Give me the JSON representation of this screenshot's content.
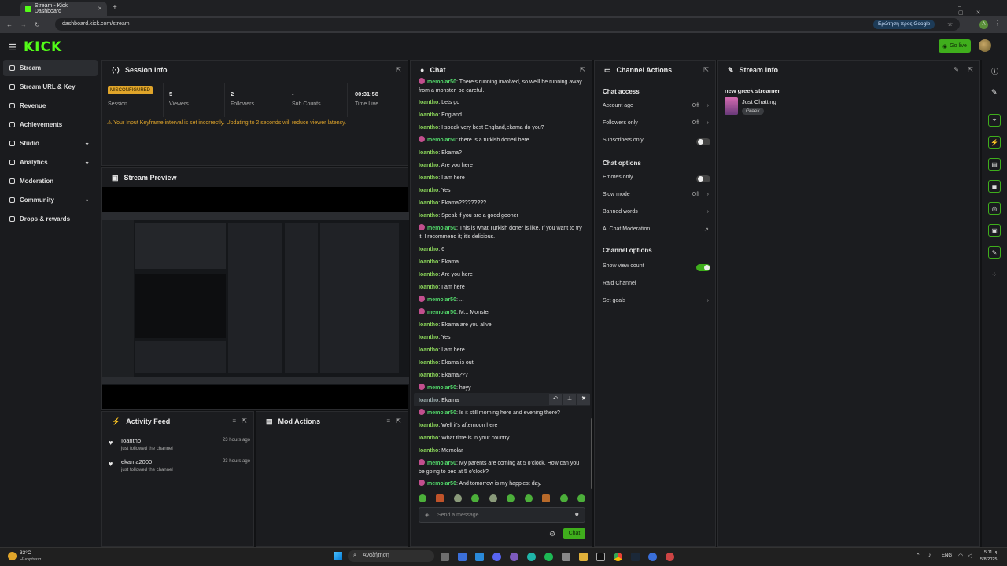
{
  "browser": {
    "tab_title": "Stream - Kick Dashboard",
    "url": "dashboard.kick.com/stream",
    "google_pill": "Ερώτηση προς Google",
    "profile_initial": "A"
  },
  "header": {
    "logo": "KICK",
    "go_live": "Go live"
  },
  "sidebar": {
    "items": [
      {
        "label": "Stream",
        "icon": "broadcast-icon",
        "active": true
      },
      {
        "label": "Stream URL & Key",
        "icon": "link-icon"
      },
      {
        "label": "Revenue",
        "icon": "dollar-icon"
      },
      {
        "label": "Achievements",
        "icon": "trophy-icon"
      },
      {
        "label": "Studio",
        "icon": "studio-icon",
        "expandable": true
      },
      {
        "label": "Analytics",
        "icon": "chart-icon",
        "expandable": true
      },
      {
        "label": "Moderation",
        "icon": "wrench-icon"
      },
      {
        "label": "Community",
        "icon": "globe-icon",
        "expandable": true
      },
      {
        "label": "Drops & rewards",
        "icon": "gift-icon"
      }
    ]
  },
  "session": {
    "title": "Session Info",
    "status": "MISCONFIGURED",
    "stats": [
      {
        "value": "",
        "label": "Session"
      },
      {
        "value": "5",
        "label": "Viewers"
      },
      {
        "value": "2",
        "label": "Followers"
      },
      {
        "value": "-",
        "label": "Sub Counts"
      },
      {
        "value": "00:31:58",
        "label": "Time Live"
      }
    ],
    "warning": "Your Input Keyframe interval is set incorrectly. Updating to 2 seconds will reduce viewer latency."
  },
  "preview": {
    "title": "Stream Preview"
  },
  "activity": {
    "title": "Activity Feed",
    "items": [
      {
        "user": "Ioantho",
        "action": "just followed the channel",
        "time": "23 hours ago"
      },
      {
        "user": "ekama2000",
        "action": "just followed the channel",
        "time": "23 hours ago"
      }
    ]
  },
  "mod": {
    "title": "Mod Actions"
  },
  "chat": {
    "title": "Chat",
    "placeholder": "Send a message",
    "send": "Chat",
    "messages": [
      {
        "user": "memolar50",
        "text": "There's running involved, so we'll be running away from a monster, be careful.",
        "mod": true
      },
      {
        "user": "Ioantho",
        "text": "Lets go"
      },
      {
        "user": "Ioantho",
        "text": "England"
      },
      {
        "user": "Ioantho",
        "text": "I speak very best England,ekama do you?"
      },
      {
        "user": "memolar50",
        "text": "there is a turkish döneri here",
        "mod": true
      },
      {
        "user": "Ioantho",
        "text": "Ekama?"
      },
      {
        "user": "Ioantho",
        "text": "Are you here"
      },
      {
        "user": "Ioantho",
        "text": "I am here"
      },
      {
        "user": "Ioantho",
        "text": "Yes"
      },
      {
        "user": "Ioantho",
        "text": "Ekama?????????"
      },
      {
        "user": "Ioantho",
        "text": "Speak if you are a good gooner"
      },
      {
        "user": "memolar50",
        "text": "This is what Turkish döner is like. If you want to try it, I recommend it; it's delicious.",
        "mod": true
      },
      {
        "user": "Ioantho",
        "text": "6"
      },
      {
        "user": "Ioantho",
        "text": "Ekama"
      },
      {
        "user": "Ioantho",
        "text": "Are you here"
      },
      {
        "user": "Ioantho",
        "text": "I am here"
      },
      {
        "user": "memolar50",
        "text": "...",
        "mod": true
      },
      {
        "user": "memolar50",
        "text": "M... Monster",
        "mod": true
      },
      {
        "user": "Ioantho",
        "text": "Ekama are you alive"
      },
      {
        "user": "Ioantho",
        "text": "Yes"
      },
      {
        "user": "Ioantho",
        "text": "I am here"
      },
      {
        "user": "Ioantho",
        "text": "Ekama is out"
      },
      {
        "user": "Ioantho",
        "text": "Ekama???"
      },
      {
        "user": "memolar50",
        "text": "heyy",
        "mod": true
      },
      {
        "user": "Ioantho",
        "text": "Ekama"
      },
      {
        "user": "memolar50",
        "text": "Is it still morning here and evening there?",
        "mod": true
      },
      {
        "user": "Ioantho",
        "text": "Well it's afternoon here"
      },
      {
        "user": "Ioantho",
        "text": "What time is in your country"
      },
      {
        "user": "Ioantho",
        "text": "Memolar"
      },
      {
        "user": "memolar50",
        "text": "My parents are coming at 5 o'clock. How can you be going to bed at 5 o'clock?",
        "mod": true
      },
      {
        "user": "memolar50",
        "text": "And tomorrow is my happiest day.",
        "mod": true
      }
    ]
  },
  "channel_actions": {
    "title": "Channel Actions",
    "chat_access": "Chat access",
    "account_age": "Account age",
    "account_age_val": "Off",
    "followers_only": "Followers only",
    "followers_only_val": "Off",
    "subscribers_only": "Subscribers only",
    "chat_options": "Chat options",
    "emotes_only": "Emotes only",
    "slow_mode": "Slow mode",
    "slow_mode_val": "Off",
    "banned_words": "Banned words",
    "ai_mod": "AI Chat Moderation",
    "channel_options": "Channel options",
    "show_view_count": "Show view count",
    "raid": "Raid Channel",
    "set_goals": "Set goals"
  },
  "stream_info": {
    "title": "Stream info",
    "stream_title": "new greek streamer",
    "category": "Just Chatting",
    "tag": "Greek"
  },
  "taskbar": {
    "temp": "33°C",
    "weather": "Ηλιοφάνεια",
    "search": "Αναζήτηση",
    "lang": "ENG",
    "time": "5:11 μμ",
    "date": "5/8/2025"
  },
  "colors": {
    "accent": "#53fc18",
    "warning": "#e0a52a",
    "mod_badge": "#c24f8e"
  }
}
